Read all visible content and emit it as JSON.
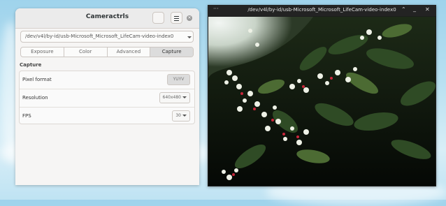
{
  "app": {
    "title": "Cameractrls",
    "device": "/dev/v4l/by-id/usb-Microsoft_Microsoft_LifeCam-video-index0",
    "tabs": [
      "Exposure",
      "Color",
      "Advanced",
      "Capture"
    ],
    "active_tab": "Capture",
    "section_title": "Capture",
    "rows": [
      {
        "label": "Pixel format",
        "value": "YUYV"
      },
      {
        "label": "Resolution",
        "value": "640x480"
      },
      {
        "label": "FPS",
        "value": "30"
      }
    ]
  },
  "video_window": {
    "title": "/dev/v4l/by-id/usb-Microsoft_Microsoft_LifeCam-video-index0"
  },
  "colors": {
    "accent": "#dcdcdc",
    "window_bg": "#f6f5f4",
    "video_bg": "#1d1d1d"
  },
  "icons": [
    "menu-icon",
    "close-icon",
    "chevron-down-icon",
    "minimize-icon",
    "maximize-icon"
  ]
}
